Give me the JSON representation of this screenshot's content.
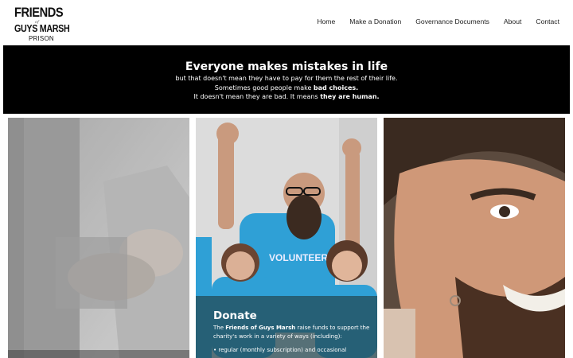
{
  "header": {
    "logo": {
      "line1": "FRIENDS",
      "line2": "of",
      "line3": "GUYS MARSH",
      "line4": "PRISON"
    },
    "nav": [
      "Home",
      "Make a Donation",
      "Governance Documents",
      "About",
      "Contact"
    ]
  },
  "banner": {
    "title": "Everyone makes mistakes in life",
    "line1": "but that doesn't mean they have to pay for them the rest of their life.",
    "line2_pre": "Sometimes good people make ",
    "line2_bold": "bad choices.",
    "line3_pre": "It doesn't mean they are bad. It means ",
    "line3_bold": "they are human."
  },
  "cards": {
    "donate": {
      "title": "Donate",
      "text_pre": "The ",
      "text_bold": "Friends of Guys Marsh",
      "text_post": " raise funds to support the charity's work in a variety of ways (including):",
      "bullet1": "regular (monthly subscription) and occasional",
      "shirt_text": "VOLUNTEER"
    }
  },
  "colors": {
    "banner_bg": "#000000",
    "panel_overlay": "#234650",
    "shirt_blue": "#2fa0d6"
  }
}
